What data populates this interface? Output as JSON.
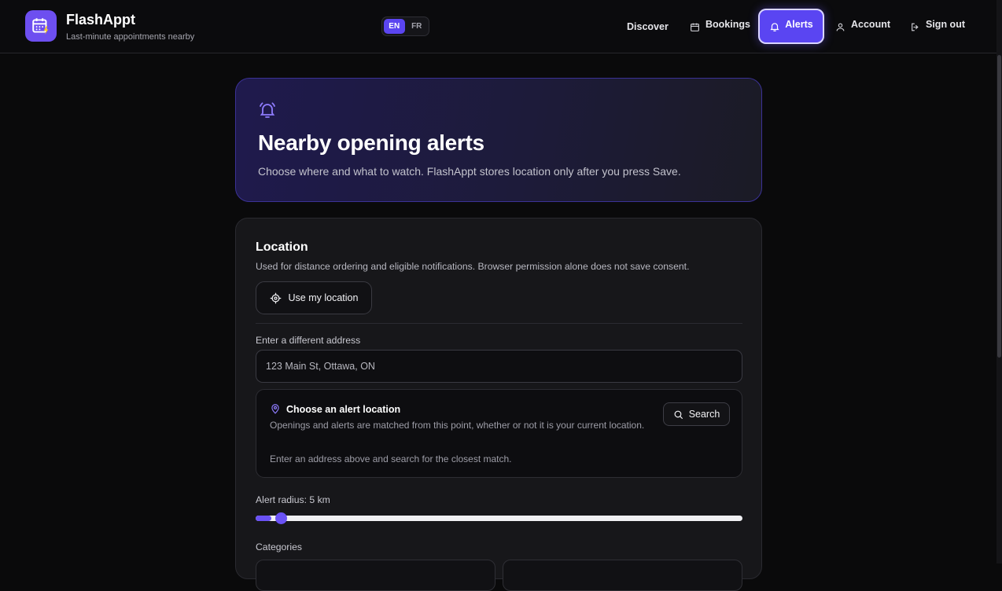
{
  "brand": {
    "name": "FlashAppt",
    "tagline": "Last-minute appointments nearby"
  },
  "language": {
    "options": [
      "EN",
      "FR"
    ],
    "selected": "EN"
  },
  "nav": {
    "discover": "Discover",
    "bookings": "Bookings",
    "alerts": "Alerts",
    "account": "Account",
    "sign_out": "Sign out",
    "active": "Alerts"
  },
  "hero": {
    "title": "Nearby opening alerts",
    "subtitle": "Choose where and what to watch. FlashAppt stores location only after you press Save."
  },
  "location": {
    "title": "Location",
    "description": "Used for distance ordering and eligible notifications. Browser permission alone does not save consent.",
    "use_location_label": "Use my location",
    "address_label": "Enter a different address",
    "address_placeholder": "123 Main St, Ottawa, ON",
    "panel": {
      "title": "Choose an alert location",
      "description": "Openings and alerts are matched from this point, whether or not it is your current location.",
      "hint": "Enter an address above and search for the closest match.",
      "search_label": "Search"
    },
    "radius_label": "Alert radius: 5 km",
    "radius_fraction": 0.033,
    "categories_label": "Categories"
  },
  "colors": {
    "accent": "#5b45f0",
    "background": "#0a0a0b",
    "card": "#17171a"
  }
}
